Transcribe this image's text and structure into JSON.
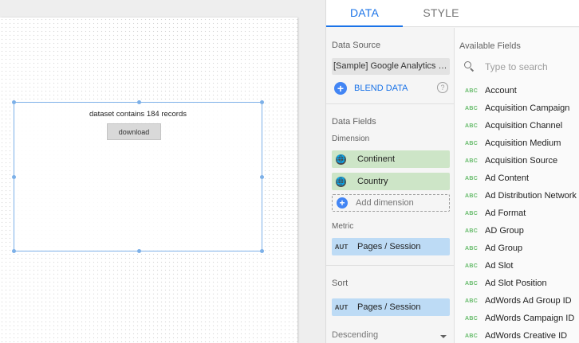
{
  "canvas": {
    "component_text": "dataset contains 184 records",
    "download_label": "download"
  },
  "tabs": [
    {
      "label": "DATA",
      "active": true
    },
    {
      "label": "STYLE",
      "active": false
    }
  ],
  "data_source": {
    "title": "Data Source",
    "name": "[Sample] Google Analytics Data",
    "blend_label": "BLEND DATA",
    "help_glyph": "?"
  },
  "data_fields": {
    "title": "Data Fields",
    "dimension_label": "Dimension",
    "dimensions": [
      {
        "icon": "globe-icon",
        "label": "Continent"
      },
      {
        "icon": "globe-icon",
        "label": "Country"
      }
    ],
    "add_dimension_label": "Add dimension",
    "metric_label": "Metric",
    "metrics": [
      {
        "type": "AUT",
        "label": "Pages / Session"
      }
    ]
  },
  "sort": {
    "title": "Sort",
    "field": {
      "type": "AUT",
      "label": "Pages / Session"
    },
    "order": "Descending"
  },
  "available_fields": {
    "title": "Available Fields",
    "search_placeholder": "Type to search",
    "items": [
      {
        "type": "ABC",
        "label": "Account"
      },
      {
        "type": "ABC",
        "label": "Acquisition Campaign"
      },
      {
        "type": "ABC",
        "label": "Acquisition Channel"
      },
      {
        "type": "ABC",
        "label": "Acquisition Medium"
      },
      {
        "type": "ABC",
        "label": "Acquisition Source"
      },
      {
        "type": "ABC",
        "label": "Ad Content"
      },
      {
        "type": "ABC",
        "label": "Ad Distribution Network"
      },
      {
        "type": "ABC",
        "label": "Ad Format"
      },
      {
        "type": "ABC",
        "label": "AD Group"
      },
      {
        "type": "ABC",
        "label": "Ad Group"
      },
      {
        "type": "ABC",
        "label": "Ad Slot"
      },
      {
        "type": "ABC",
        "label": "Ad Slot Position"
      },
      {
        "type": "ABC",
        "label": "AdWords Ad Group ID"
      },
      {
        "type": "ABC",
        "label": "AdWords Campaign ID"
      },
      {
        "type": "ABC",
        "label": "AdWords Creative ID"
      }
    ]
  },
  "colors": {
    "accent": "#1a73e8",
    "dimension_chip": "#cde5c7",
    "metric_chip": "#bddbf5",
    "selection": "#7cb0e8"
  }
}
